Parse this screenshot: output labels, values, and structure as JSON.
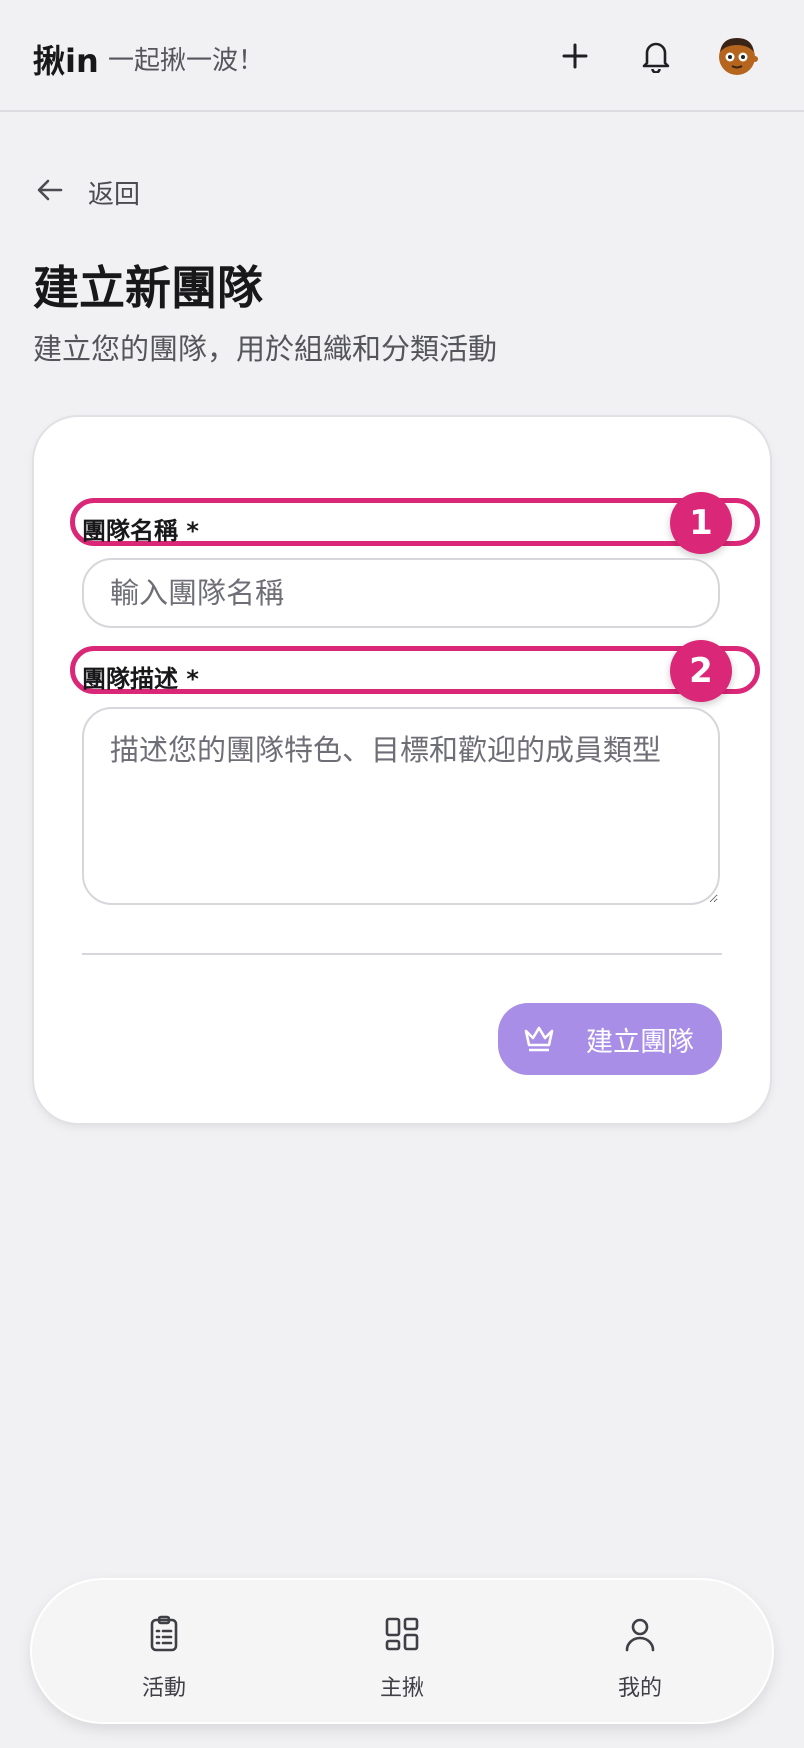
{
  "header": {
    "brand": "揪in",
    "tagline": "一起揪一波！",
    "add_icon": "plus-icon",
    "notify_icon": "bell-icon",
    "avatar_icon": "user-avatar"
  },
  "back": {
    "label": "返回",
    "icon": "arrow-left-icon"
  },
  "page": {
    "title": "建立新團隊",
    "subtitle": "建立您的團隊，用於組織和分類活動"
  },
  "form": {
    "name_label": "團隊名稱 *",
    "name_placeholder": "輸入團隊名稱",
    "name_value": "",
    "desc_label": "團隊描述 *",
    "desc_placeholder": "描述您的團隊特色、目標和歡迎的成員類型",
    "desc_value": "",
    "submit_label": "建立團隊",
    "submit_icon": "crown-icon"
  },
  "annotations": {
    "badge1": "1",
    "badge2": "2",
    "highlight_color": "#db2777"
  },
  "colors": {
    "accent": "#a98ee8",
    "background": "#f1f1f3"
  },
  "bottom_nav": {
    "items": [
      {
        "label": "活動",
        "icon": "clipboard-list-icon"
      },
      {
        "label": "主揪",
        "icon": "grid-icon"
      },
      {
        "label": "我的",
        "icon": "user-icon"
      }
    ]
  }
}
